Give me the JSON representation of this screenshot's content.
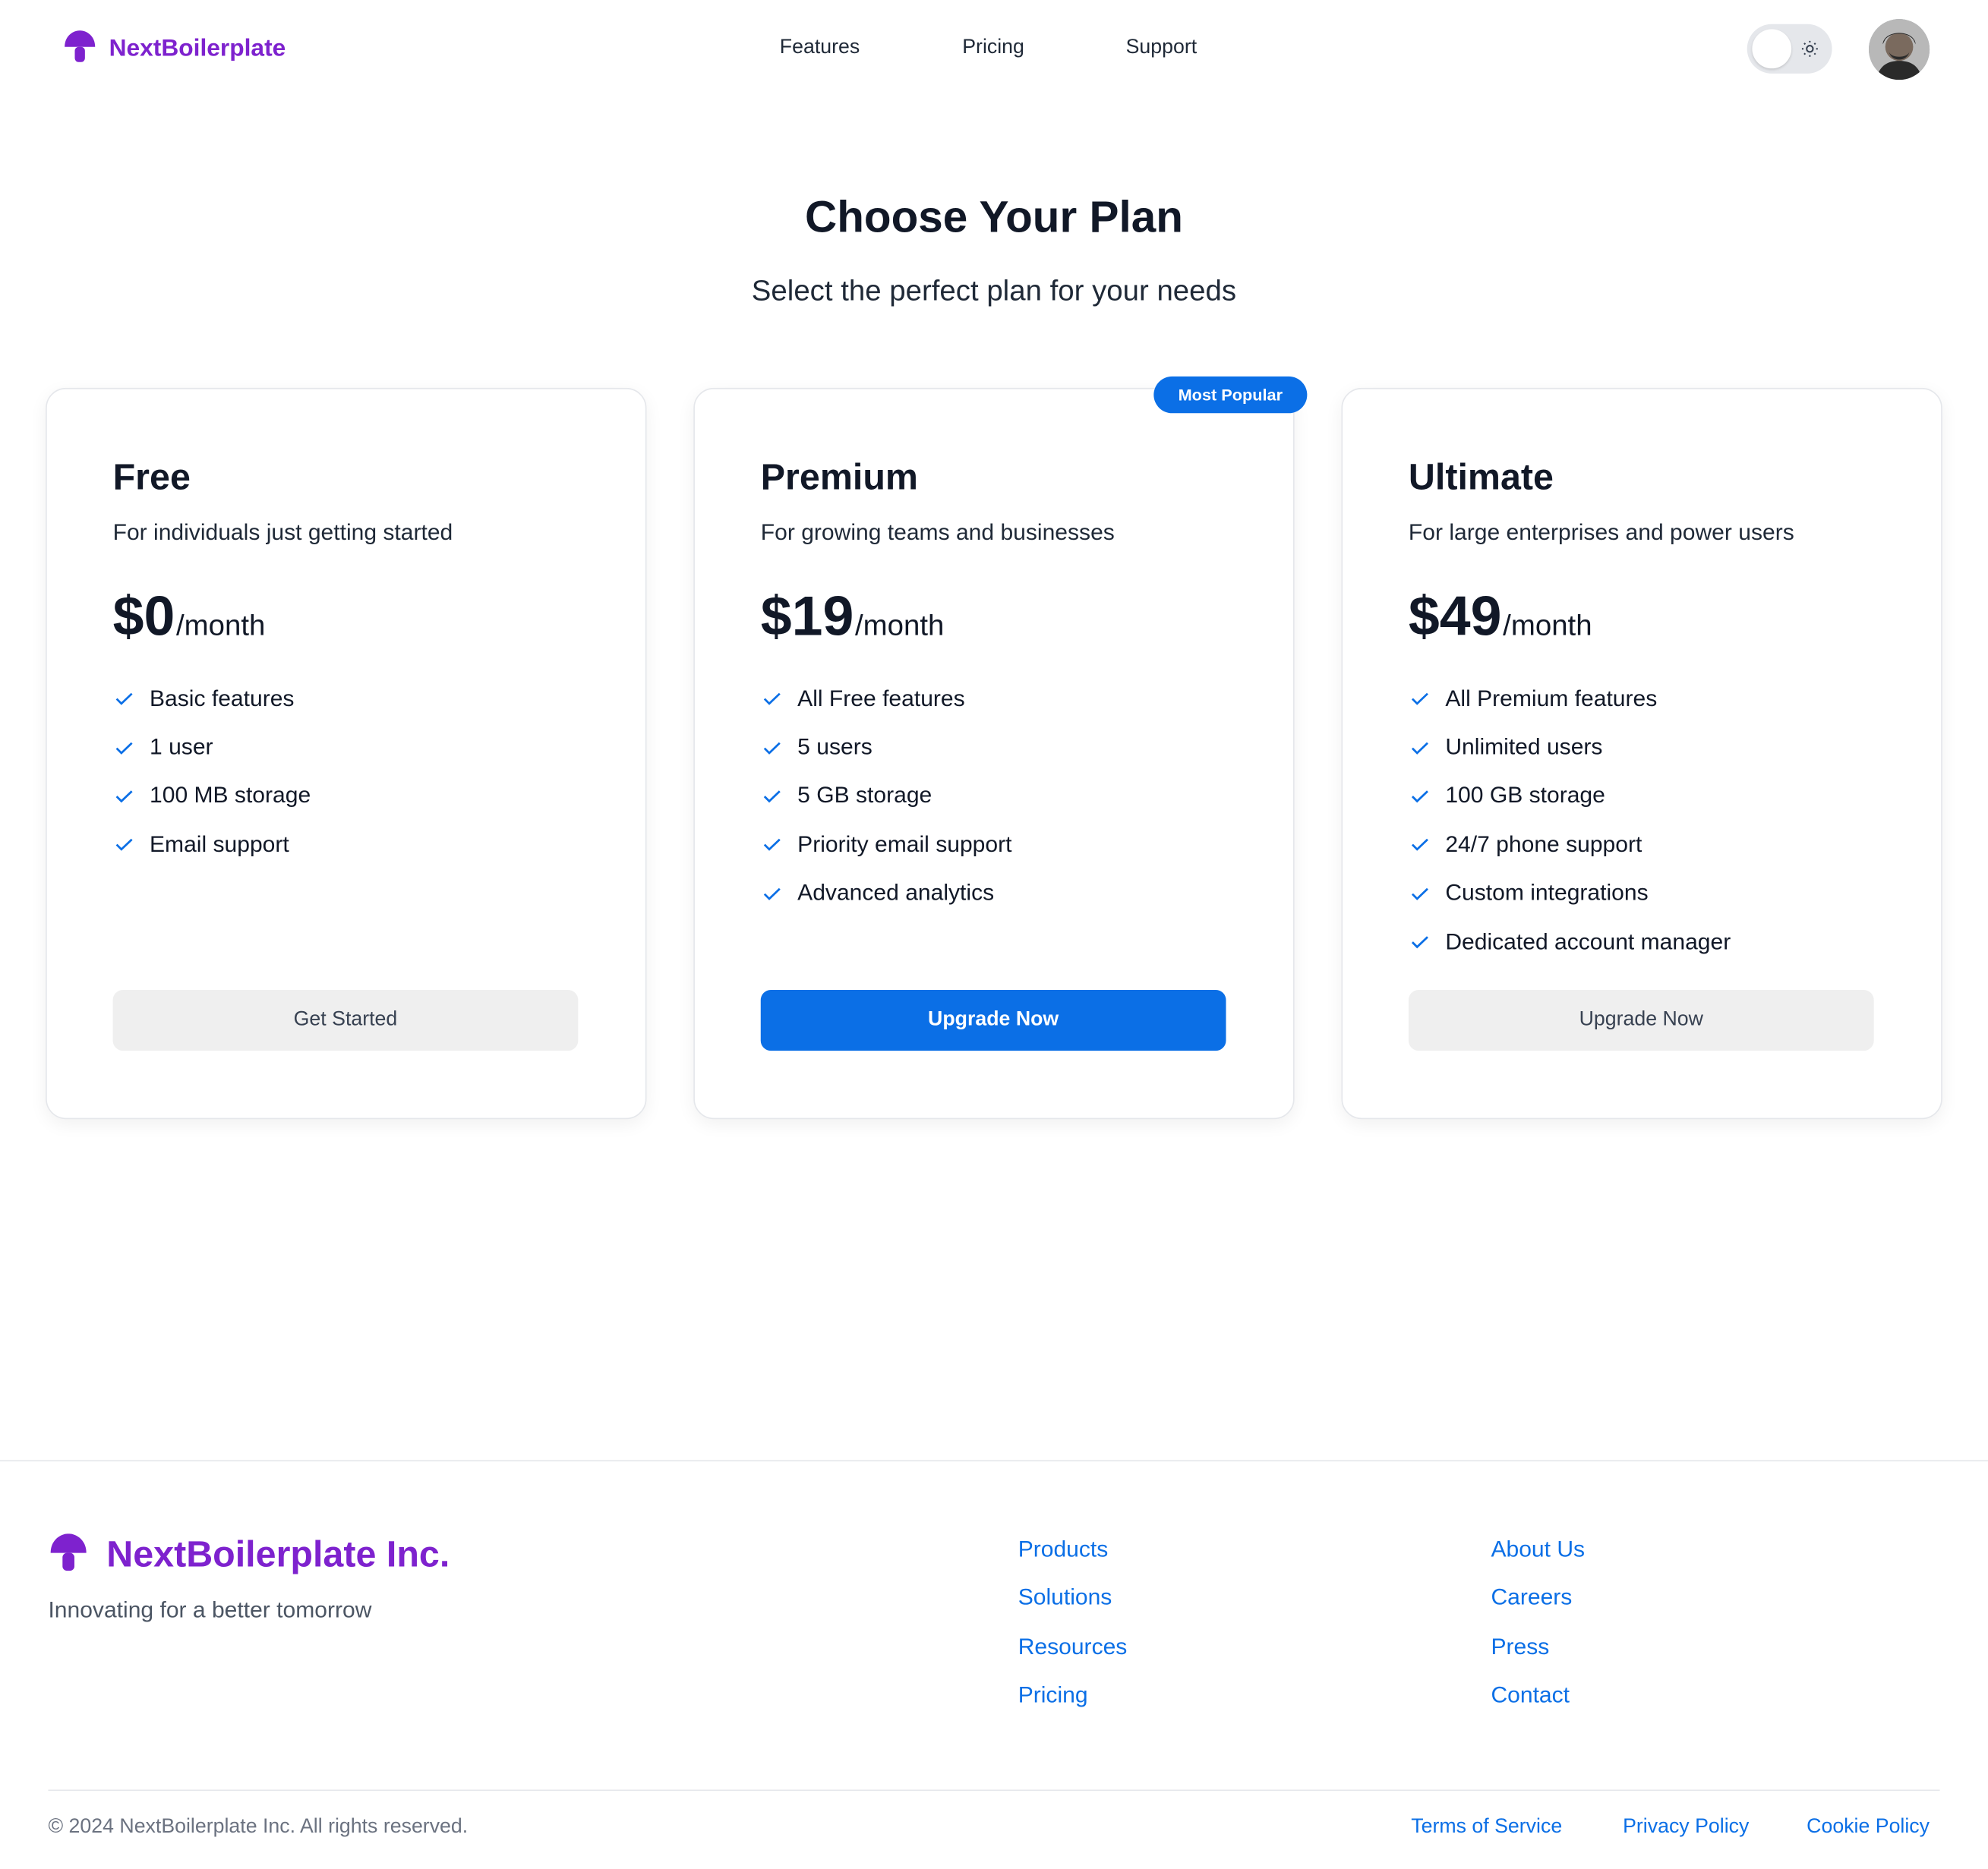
{
  "header": {
    "brand": "NextBoilerplate",
    "nav": [
      "Features",
      "Pricing",
      "Support"
    ]
  },
  "hero": {
    "title": "Choose Your Plan",
    "subtitle": "Select the perfect plan for your needs"
  },
  "badge": "Most Popular",
  "plans": [
    {
      "name": "Free",
      "description": "For individuals just getting started",
      "price": "$0",
      "period": "/month",
      "features": [
        "Basic features",
        "1 user",
        "100 MB storage",
        "Email support"
      ],
      "button": "Get Started"
    },
    {
      "name": "Premium",
      "description": "For growing teams and businesses",
      "price": "$19",
      "period": "/month",
      "features": [
        "All Free features",
        "5 users",
        "5 GB storage",
        "Priority email support",
        "Advanced analytics"
      ],
      "button": "Upgrade Now"
    },
    {
      "name": "Ultimate",
      "description": "For large enterprises and power users",
      "price": "$49",
      "period": "/month",
      "features": [
        "All Premium features",
        "Unlimited users",
        "100 GB storage",
        "24/7 phone support",
        "Custom integrations",
        "Dedicated account manager"
      ],
      "button": "Upgrade Now"
    }
  ],
  "footer": {
    "brand": "NextBoilerplate Inc.",
    "tagline": "Innovating for a better tomorrow",
    "col1": [
      "Products",
      "Solutions",
      "Resources",
      "Pricing"
    ],
    "col2": [
      "About Us",
      "Careers",
      "Press",
      "Contact"
    ],
    "copyright": "© 2024 NextBoilerplate Inc. All rights reserved.",
    "legal": [
      "Terms of Service",
      "Privacy Policy",
      "Cookie Policy"
    ]
  },
  "colors": {
    "brand": "#7e22ce",
    "accent": "#0b6fe6"
  },
  "icons": {
    "logo": "mushroom-logo-icon",
    "theme": "sun-icon",
    "feature": "check-icon"
  }
}
